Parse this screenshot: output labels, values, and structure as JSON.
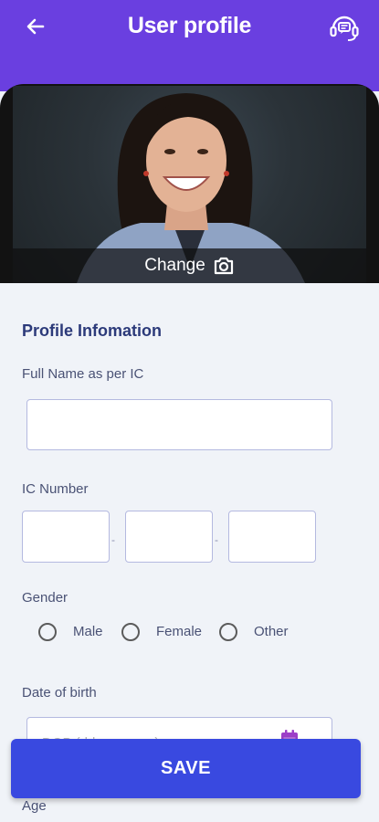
{
  "header": {
    "title": "User profile",
    "back_icon": "arrow-left-icon",
    "support_icon": "headset-chat-icon",
    "background": "#6a3fe0"
  },
  "profile_photo": {
    "change_label": "Change",
    "camera_icon": "camera-icon"
  },
  "form": {
    "section_title": "Profile Infomation",
    "full_name": {
      "label": "Full Name as per IC",
      "value": ""
    },
    "ic_number": {
      "label": "IC Number",
      "parts": [
        "",
        "",
        ""
      ]
    },
    "gender": {
      "label": "Gender",
      "options": [
        "Male",
        "Female",
        "Other"
      ],
      "selected": null
    },
    "dob": {
      "label": "Date of birth",
      "placeholder": "DOB (dd-mm-yyyy)",
      "calendar_icon": "calendar-icon"
    },
    "age": {
      "label": "Age"
    }
  },
  "actions": {
    "save_label": "SAVE",
    "accent": "#3949e0"
  }
}
